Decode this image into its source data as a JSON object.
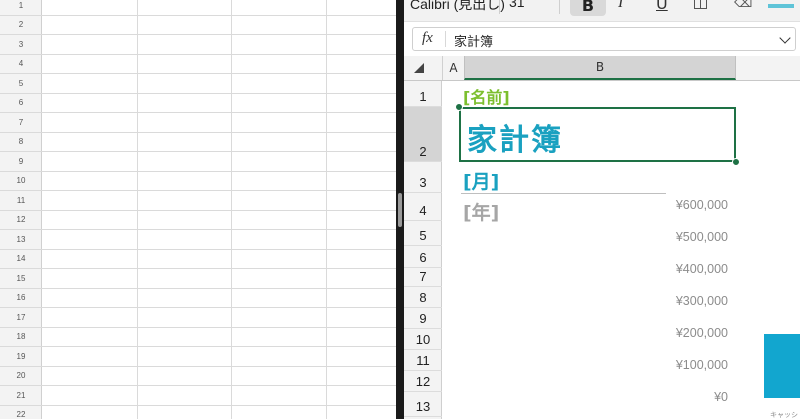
{
  "left_pane": {
    "row_numbers": [
      "1",
      "2",
      "3",
      "4",
      "5",
      "6",
      "7",
      "8",
      "9",
      "10",
      "11",
      "12",
      "13",
      "14",
      "15",
      "16",
      "17",
      "18",
      "19",
      "20",
      "21",
      "22"
    ]
  },
  "ribbon": {
    "font_name": "Calibri (見出し)",
    "font_size": "31",
    "bold_label": "B",
    "italic_label": "I",
    "underline_label": "U",
    "bold_active": true,
    "accent_color": "#5fc4d8"
  },
  "formula_bar": {
    "fx_label": "fx",
    "value": "家計簿"
  },
  "column_headers": [
    "A",
    "B"
  ],
  "row_headers": [
    "1",
    "2",
    "3",
    "4",
    "5",
    "6",
    "7",
    "8",
    "9",
    "10",
    "11",
    "12",
    "13"
  ],
  "cells": {
    "name": "[名前]",
    "title": "家計簿",
    "month": "[月]",
    "year": "[年]"
  },
  "colors": {
    "name_green": "#7cbf2e",
    "title_teal": "#1aa1c0",
    "year_gray": "#a6a6a6",
    "selection_green": "#1e7145",
    "bar_blue": "#12a6cf"
  },
  "chart_data": {
    "type": "bar",
    "y_ticks": [
      "¥600,000",
      "¥500,000",
      "¥400,000",
      "¥300,000",
      "¥200,000",
      "¥100,000",
      "¥0"
    ],
    "ylim": [
      0,
      600000
    ],
    "categories": [
      "キャッシ"
    ],
    "values": [
      200000
    ]
  }
}
